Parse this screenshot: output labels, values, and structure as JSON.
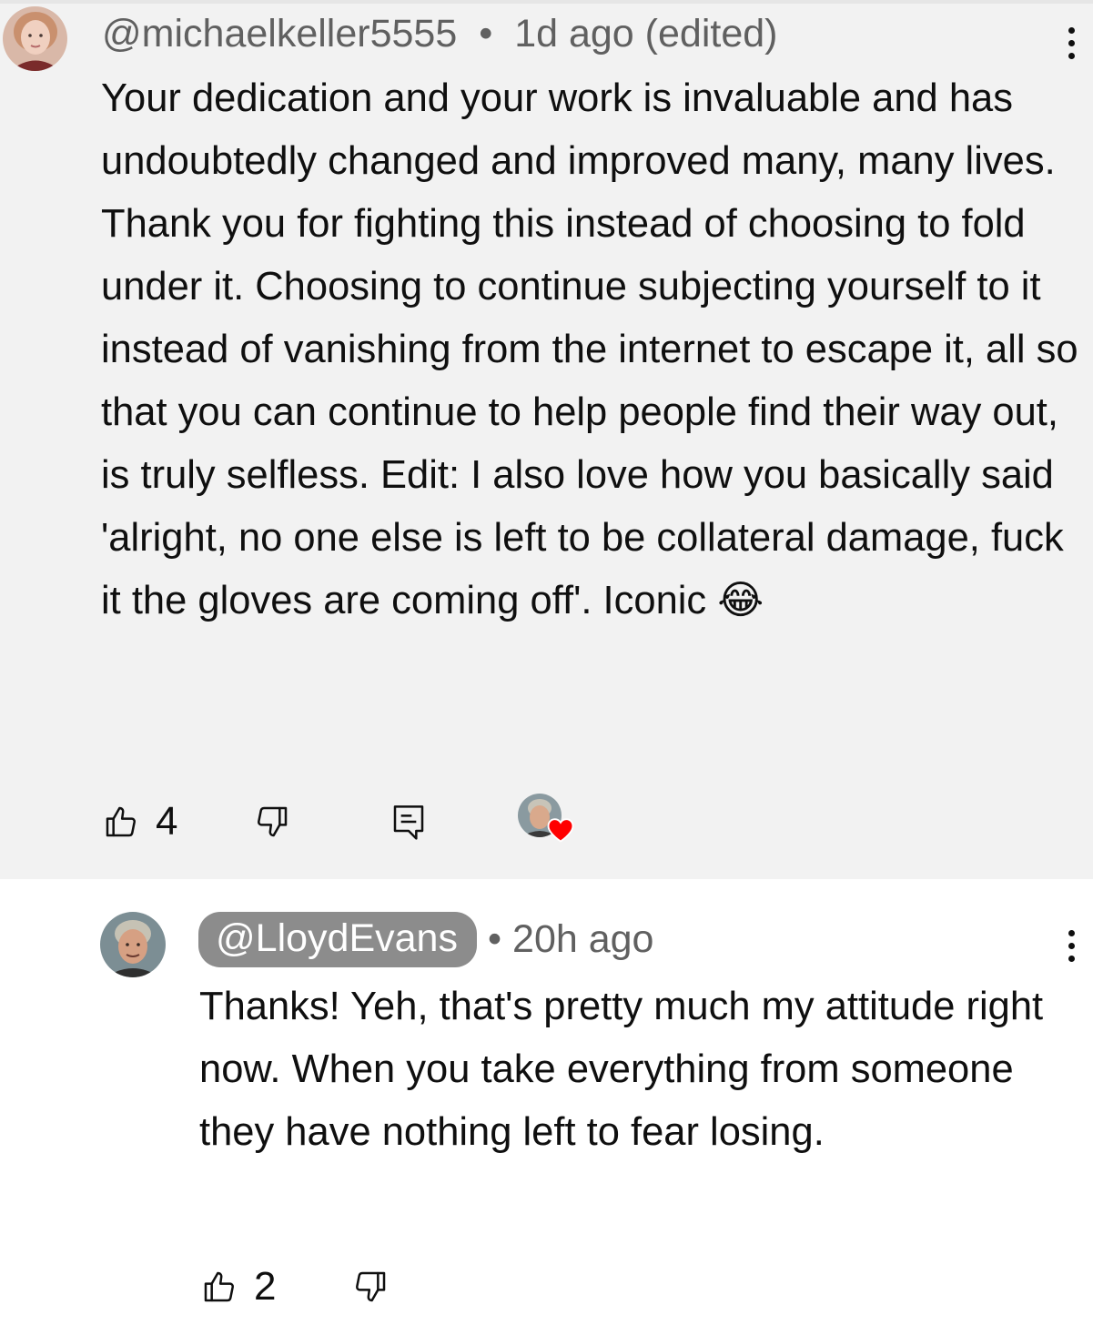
{
  "comments": [
    {
      "handle": "@michaelkeller5555",
      "separator": "•",
      "time": "1d ago (edited)",
      "text": "Your dedication and your work is invaluable and has undoubtedly changed and improved many, many lives. Thank you for fighting this instead of choosing to fold under it. Choosing to continue subjecting yourself to it instead of vanishing from the internet to escape it, all so that you can continue to help people find their way out, is truly selfless. Edit: I also love how you basically said 'alright, no one else is left to be collateral damage, fuck it the gloves are coming off'. Iconic 😂",
      "likes": "4"
    },
    {
      "handle": "@LloydEvans",
      "separator": "•",
      "time": "20h ago",
      "text": "Thanks! Yeh, that's pretty much my attitude right now. When you take everything from someone they have nothing left to fear losing.",
      "likes": "2"
    }
  ],
  "icons": {
    "like": "thumbs-up-icon",
    "dislike": "thumbs-down-icon",
    "reply": "reply-icon",
    "more": "more-vertical-icon",
    "creator_heart": "creator-heart-icon"
  },
  "colors": {
    "highlight_bg": "#f2f2f2",
    "handle_pill": "#8c8c8c",
    "heart": "#ff0000"
  }
}
